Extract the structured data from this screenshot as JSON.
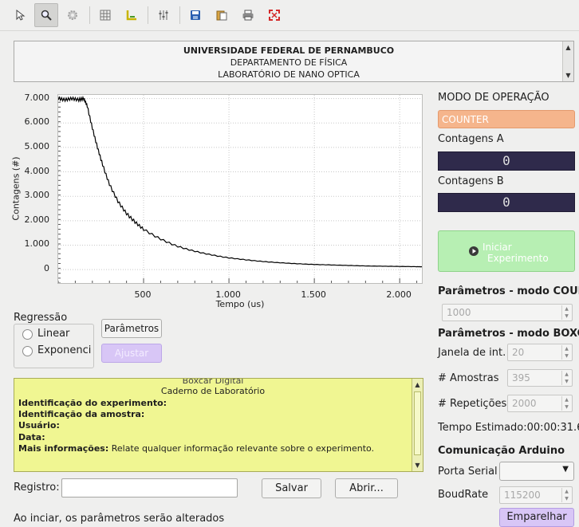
{
  "header": {
    "line1": "UNIVERSIDADE FEDERAL DE PERNAMBUCO",
    "line2": "DEPARTAMENTO DE FÍSICA",
    "line3": "LABORATÓRIO DE NANO OPTICA"
  },
  "toolbar": {
    "items": [
      "pointer-icon",
      "zoom-icon",
      "gear-icon",
      "grid-icon",
      "axis-icon",
      "sliders-icon",
      "save-icon",
      "copy-icon",
      "print-icon",
      "fullscreen-icon"
    ]
  },
  "chart_data": {
    "type": "line",
    "xlabel": "Tempo (us)",
    "ylabel": "Contagens (#)",
    "xlim": [
      0,
      2130
    ],
    "ylim": [
      -550,
      7150
    ],
    "x_ticks": [
      500,
      1000,
      1500,
      2000
    ],
    "x_tick_labels": [
      "500",
      "1.000",
      "1.500",
      "2.000"
    ],
    "y_ticks": [
      0,
      1000,
      2000,
      3000,
      4000,
      5000,
      6000,
      7000
    ],
    "y_tick_labels": [
      "0",
      "1.000",
      "2.000",
      "3.000",
      "4.000",
      "5.000",
      "6.000",
      "7.000"
    ],
    "grid": true,
    "color": "#000000",
    "x": [
      0,
      40,
      80,
      120,
      150,
      170,
      200,
      230,
      260,
      300,
      350,
      400,
      450,
      500,
      600,
      700,
      800,
      900,
      1000,
      1100,
      1200,
      1300,
      1400,
      1500,
      1600,
      1700,
      1800,
      1900,
      2000,
      2100,
      2130
    ],
    "y": [
      7000,
      6950,
      7000,
      6950,
      7000,
      6700,
      5800,
      5000,
      4300,
      3500,
      2800,
      2300,
      1950,
      1650,
      1250,
      950,
      750,
      600,
      480,
      400,
      330,
      280,
      240,
      210,
      190,
      170,
      150,
      140,
      130,
      120,
      115
    ]
  },
  "regression": {
    "title": "Regressão",
    "options": [
      "Linear",
      "Exponenci"
    ],
    "params_button": "Parâmetros",
    "fit_button": "Ajustar"
  },
  "right_panel": {
    "mode_title": "MODO DE OPERAÇÃO",
    "mode_value": "COUNTER",
    "counts_a_label": "Contagens A",
    "counts_a_value": "0",
    "counts_b_label": "Contagens B",
    "counts_b_value": "0",
    "start_button_line1": "Iniciar",
    "start_button_line2": "Experimento",
    "params_counter_title": "Parâmetros - modo COUN",
    "counter_value": "1000",
    "params_boxcar_title": "Parâmetros - modo BOXCA",
    "window_label": "Janela de int.",
    "window_value": "20",
    "samples_label": "# Amostras",
    "samples_value": "395",
    "repeats_label": "# Repetições",
    "repeats_value": "2000",
    "estimated_time": "Tempo Estimado:00:00:31.6",
    "arduino_title": "Comunicação Arduino",
    "serial_port_label": "Porta Serial",
    "serial_port_value": "",
    "baud_label": "BoudRate",
    "baud_value": "115200",
    "pair_button": "Emparelhar"
  },
  "notebook": {
    "line_top": "Boxcar Digital",
    "line_caderno": "Caderno de Laboratório",
    "exp_id": "Identificação do experimento:",
    "sample_id": "Identificação da amostra:",
    "user": "Usuário:",
    "date": "Data:",
    "more_info_label": "Mais informações:",
    "more_info_text": " Relate qualquer informação relevante sobre o experimento."
  },
  "registry": {
    "label": "Registro:",
    "value": "",
    "save_button": "Salvar",
    "open_button": "Abrir..."
  },
  "status": "Ao inciar, os parâmetros serão alterados"
}
